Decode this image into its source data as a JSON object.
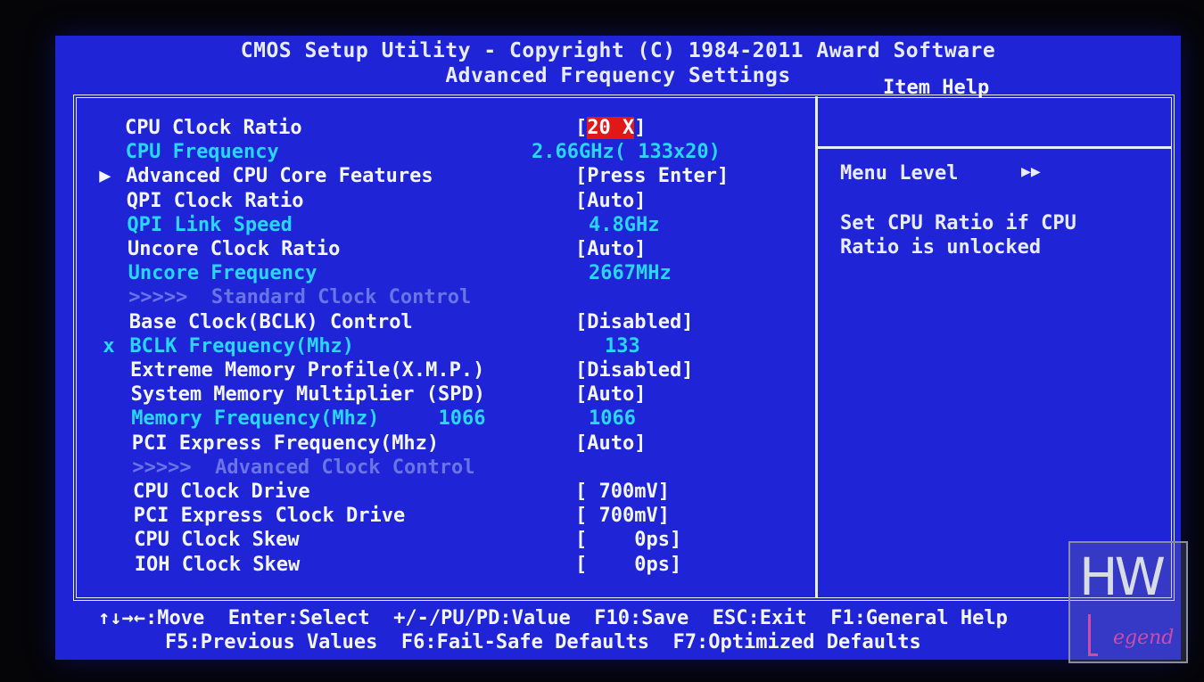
{
  "header": {
    "title": "CMOS Setup Utility - Copyright (C) 1984-2011 Award Software",
    "subtitle": "Advanced Frequency Settings"
  },
  "settings": [
    {
      "label": "CPU Clock Ratio",
      "value_pre": "[",
      "value_hl": "20 X",
      "value_post": "]",
      "kind": "normal"
    },
    {
      "label": "CPU Frequency",
      "value": "2.66GHz( 133x20)",
      "kind": "info"
    },
    {
      "label": "Advanced CPU Core Features",
      "value": "[Press Enter]",
      "kind": "normal",
      "marker": "▶"
    },
    {
      "label": "QPI Clock Ratio",
      "value": "[Auto]",
      "kind": "normal"
    },
    {
      "label": "QPI Link Speed",
      "value": "4.8GHz",
      "kind": "info"
    },
    {
      "label": "Uncore Clock Ratio",
      "value": "[Auto]",
      "kind": "normal"
    },
    {
      "label": "Uncore Frequency",
      "value": "2667MHz",
      "kind": "info"
    },
    {
      "label": ">>>>>  Standard Clock Control",
      "value": "",
      "kind": "disabled"
    },
    {
      "label": "Base Clock(BCLK) Control",
      "value": "[Disabled]",
      "kind": "normal"
    },
    {
      "label": "BCLK Frequency(Mhz)",
      "value": "133",
      "kind": "info",
      "marker": "x"
    },
    {
      "label": "Extreme Memory Profile(X.M.P.)",
      "value": "[Disabled]",
      "kind": "normal"
    },
    {
      "label": "System Memory Multiplier (SPD)",
      "value": "[Auto]",
      "kind": "normal"
    },
    {
      "label": "Memory Frequency(Mhz)     1066",
      "value": "1066",
      "kind": "info"
    },
    {
      "label": "PCI Express Frequency(Mhz)",
      "value": "[Auto]",
      "kind": "normal"
    },
    {
      "label": ">>>>>  Advanced Clock Control",
      "value": "",
      "kind": "disabled"
    },
    {
      "label": "CPU Clock Drive",
      "value": "[ 700mV]",
      "kind": "normal"
    },
    {
      "label": "PCI Express Clock Drive",
      "value": "[ 700mV]",
      "kind": "normal"
    },
    {
      "label": "CPU Clock Skew",
      "value": "[    0ps]",
      "kind": "normal"
    },
    {
      "label": "IOH Clock Skew",
      "value": "[    0ps]",
      "kind": "normal"
    }
  ],
  "help": {
    "title": "Item Help",
    "menu_level_label": "Menu Level",
    "menu_level_arrows": "▶▶",
    "line1": "Set CPU Ratio if CPU",
    "line2": "Ratio is unlocked"
  },
  "footer": {
    "line1": "↑↓→←:Move  Enter:Select  +/-/PU/PD:Value  F10:Save  ESC:Exit  F1:General Help",
    "line2": "F5:Previous Values  F6:Fail-Safe Defaults  F7:Optimized Defaults"
  },
  "watermark": {
    "text": "HW",
    "subtext": "egend"
  },
  "colors": {
    "background": "#1f24d6",
    "text": "#f4f6ff",
    "info_text": "#28d6ff",
    "disabled_text": "#6a74e6",
    "highlight": "#e01818"
  }
}
